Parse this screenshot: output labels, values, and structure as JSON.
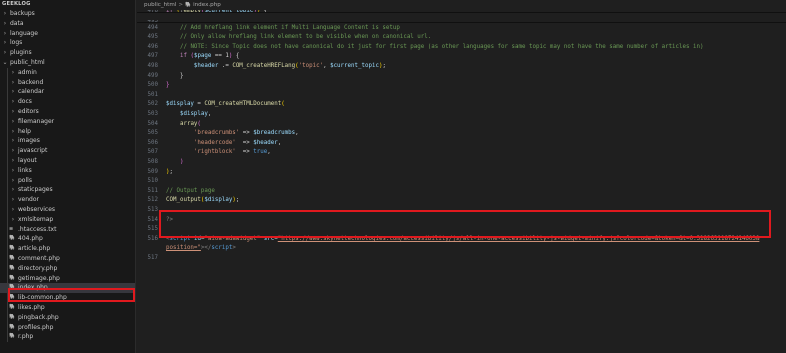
{
  "explorer": {
    "root_label": "GEEKLOG",
    "items": [
      {
        "label": "backups",
        "type": "folder",
        "depth": 0,
        "expanded": false
      },
      {
        "label": "data",
        "type": "folder",
        "depth": 0,
        "expanded": false
      },
      {
        "label": "language",
        "type": "folder",
        "depth": 0,
        "expanded": false
      },
      {
        "label": "logs",
        "type": "folder",
        "depth": 0,
        "expanded": false
      },
      {
        "label": "plugins",
        "type": "folder",
        "depth": 0,
        "expanded": false
      },
      {
        "label": "public_html",
        "type": "folder",
        "depth": 0,
        "expanded": true
      },
      {
        "label": "admin",
        "type": "folder",
        "depth": 1,
        "expanded": false
      },
      {
        "label": "backend",
        "type": "folder",
        "depth": 1,
        "expanded": false
      },
      {
        "label": "calendar",
        "type": "folder",
        "depth": 1,
        "expanded": false
      },
      {
        "label": "docs",
        "type": "folder",
        "depth": 1,
        "expanded": false
      },
      {
        "label": "editors",
        "type": "folder",
        "depth": 1,
        "expanded": false
      },
      {
        "label": "filemanager",
        "type": "folder",
        "depth": 1,
        "expanded": false
      },
      {
        "label": "help",
        "type": "folder",
        "depth": 1,
        "expanded": false
      },
      {
        "label": "images",
        "type": "folder",
        "depth": 1,
        "expanded": false
      },
      {
        "label": "javascript",
        "type": "folder",
        "depth": 1,
        "expanded": false
      },
      {
        "label": "layout",
        "type": "folder",
        "depth": 1,
        "expanded": false
      },
      {
        "label": "links",
        "type": "folder",
        "depth": 1,
        "expanded": false
      },
      {
        "label": "polls",
        "type": "folder",
        "depth": 1,
        "expanded": false
      },
      {
        "label": "staticpages",
        "type": "folder",
        "depth": 1,
        "expanded": false
      },
      {
        "label": "vendor",
        "type": "folder",
        "depth": 1,
        "expanded": false
      },
      {
        "label": "webservices",
        "type": "folder",
        "depth": 1,
        "expanded": false
      },
      {
        "label": "xmlsitemap",
        "type": "folder",
        "depth": 1,
        "expanded": false
      },
      {
        "label": ".htaccess.txt",
        "type": "file",
        "icon": "list-file-icon",
        "icon_glyph": "≡",
        "depth": 1
      },
      {
        "label": "404.php",
        "type": "file",
        "icon": "php-file-icon",
        "icon_glyph": "🐘",
        "depth": 1
      },
      {
        "label": "article.php",
        "type": "file",
        "icon": "php-file-icon",
        "icon_glyph": "🐘",
        "depth": 1
      },
      {
        "label": "comment.php",
        "type": "file",
        "icon": "php-file-icon",
        "icon_glyph": "🐘",
        "depth": 1
      },
      {
        "label": "directory.php",
        "type": "file",
        "icon": "php-file-icon",
        "icon_glyph": "🐘",
        "depth": 1
      },
      {
        "label": "getimage.php",
        "type": "file",
        "icon": "php-file-icon",
        "icon_glyph": "🐘",
        "depth": 1
      },
      {
        "label": "index.php",
        "type": "file",
        "icon": "php-file-icon",
        "icon_glyph": "🐘",
        "depth": 1,
        "selected": true,
        "highlighted": true
      },
      {
        "label": "lib-common.php",
        "type": "file",
        "icon": "php-file-icon",
        "icon_glyph": "🐘",
        "depth": 1
      },
      {
        "label": "likes.php",
        "type": "file",
        "icon": "php-file-icon",
        "icon_glyph": "🐘",
        "depth": 1
      },
      {
        "label": "pingback.php",
        "type": "file",
        "icon": "php-file-icon",
        "icon_glyph": "🐘",
        "depth": 1
      },
      {
        "label": "profiles.php",
        "type": "file",
        "icon": "php-file-icon",
        "icon_glyph": "🐘",
        "depth": 1
      },
      {
        "label": "r.php",
        "type": "file",
        "icon": "php-file-icon",
        "icon_glyph": "🐘",
        "depth": 1
      }
    ]
  },
  "breadcrumb": {
    "folder": "public_html",
    "separator": ">",
    "file_icon": "php-file-icon",
    "file_icon_glyph": "🐘",
    "file": "index.php"
  },
  "editor": {
    "lines": [
      {
        "n": "476",
        "shadowed": true,
        "tokens": [
          [
            "kw",
            "if "
          ],
          [
            "br",
            "("
          ],
          [
            "pl",
            "!"
          ],
          [
            "fn",
            "empty"
          ],
          [
            "br2",
            "("
          ],
          [
            "var",
            "$current_topic"
          ],
          [
            "br2",
            ")"
          ],
          [
            "br",
            ")"
          ],
          [
            "pl",
            " {"
          ]
        ]
      },
      {
        "n": "493",
        "shadowed": true,
        "tokens": [
          [
            "pl",
            " "
          ]
        ]
      },
      {
        "n": "494",
        "tokens": [
          [
            "pl",
            "    "
          ],
          [
            "cm",
            "// Add hreflang link element if Multi Language Content is setup"
          ]
        ]
      },
      {
        "n": "495",
        "tokens": [
          [
            "pl",
            "    "
          ],
          [
            "cm",
            "// Only allow hreflang link element to be visible when on canonical url."
          ]
        ]
      },
      {
        "n": "496",
        "tokens": [
          [
            "pl",
            "    "
          ],
          [
            "cm",
            "// NOTE: Since Topic does not have canonical do it just for first page (as other languages for same topic may not have the same number of articles in)"
          ]
        ]
      },
      {
        "n": "497",
        "tokens": [
          [
            "pl",
            "    "
          ],
          [
            "kw",
            "if "
          ],
          [
            "br2",
            "("
          ],
          [
            "var",
            "$page"
          ],
          [
            "pl",
            " == 1"
          ],
          [
            "br2",
            ")"
          ],
          [
            "pl",
            " {"
          ]
        ]
      },
      {
        "n": "498",
        "tokens": [
          [
            "pl",
            "        "
          ],
          [
            "var",
            "$header"
          ],
          [
            "pl",
            " .= "
          ],
          [
            "fn",
            "COM_createHREFLang"
          ],
          [
            "br",
            "("
          ],
          [
            "str",
            "'topic'"
          ],
          [
            "pl",
            ", "
          ],
          [
            "var",
            "$current_topic"
          ],
          [
            "br",
            ")"
          ],
          [
            "pl",
            ";"
          ]
        ]
      },
      {
        "n": "499",
        "tokens": [
          [
            "pl",
            "    }"
          ]
        ]
      },
      {
        "n": "500",
        "tokens": [
          [
            "br2",
            "}"
          ]
        ]
      },
      {
        "n": "501",
        "tokens": [
          [
            "pl",
            ""
          ]
        ]
      },
      {
        "n": "502",
        "tokens": [
          [
            "var",
            "$display"
          ],
          [
            "pl",
            " = "
          ],
          [
            "fn",
            "COM_createHTMLDocument"
          ],
          [
            "br",
            "("
          ]
        ]
      },
      {
        "n": "503",
        "tokens": [
          [
            "pl",
            "    "
          ],
          [
            "var",
            "$display"
          ],
          [
            "pl",
            ","
          ]
        ]
      },
      {
        "n": "504",
        "tokens": [
          [
            "pl",
            "    "
          ],
          [
            "fn",
            "array"
          ],
          [
            "br2",
            "("
          ]
        ]
      },
      {
        "n": "505",
        "tokens": [
          [
            "pl",
            "        "
          ],
          [
            "str",
            "'breadcrumbs'"
          ],
          [
            "pl",
            " => "
          ],
          [
            "var",
            "$breadcrumbs"
          ],
          [
            "pl",
            ","
          ]
        ]
      },
      {
        "n": "506",
        "tokens": [
          [
            "pl",
            "        "
          ],
          [
            "str",
            "'headercode'"
          ],
          [
            "pl",
            "  => "
          ],
          [
            "var",
            "$header"
          ],
          [
            "pl",
            ","
          ]
        ]
      },
      {
        "n": "507",
        "tokens": [
          [
            "pl",
            "        "
          ],
          [
            "str",
            "'rightblock'"
          ],
          [
            "pl",
            "  => "
          ],
          [
            "tn",
            "true"
          ],
          [
            "pl",
            ","
          ]
        ]
      },
      {
        "n": "508",
        "tokens": [
          [
            "pl",
            "    "
          ],
          [
            "br2",
            ")"
          ]
        ]
      },
      {
        "n": "509",
        "tokens": [
          [
            "br",
            ")"
          ],
          [
            "pl",
            ";"
          ]
        ]
      },
      {
        "n": "510",
        "tokens": [
          [
            "pl",
            ""
          ]
        ]
      },
      {
        "n": "511",
        "tokens": [
          [
            "cm",
            "// Output page"
          ]
        ]
      },
      {
        "n": "512",
        "tokens": [
          [
            "fn",
            "COM_output"
          ],
          [
            "br",
            "("
          ],
          [
            "var",
            "$display"
          ],
          [
            "br",
            ")"
          ],
          [
            "pl",
            ";"
          ]
        ]
      },
      {
        "n": "513",
        "tokens": [
          [
            "pl",
            ""
          ]
        ]
      },
      {
        "n": "514",
        "tokens": [
          [
            "tag",
            "?>"
          ]
        ]
      },
      {
        "n": "515",
        "tokens": [
          [
            "pl",
            ""
          ]
        ]
      },
      {
        "n": "516",
        "highlighted": true,
        "tokens": [
          [
            "tag",
            "<"
          ],
          [
            "tn",
            "script"
          ],
          [
            "pl",
            " "
          ],
          [
            "an",
            "id"
          ],
          [
            "pl",
            "="
          ],
          [
            "av2",
            "\"aioa-adawidget\""
          ],
          [
            "pl",
            " "
          ],
          [
            "an",
            "src"
          ],
          [
            "pl",
            "="
          ],
          [
            "av",
            "\"https://www.skynettechnologies.com/accessibility/js/all-in-one-accessibility-js-widget-minify.js?colorcode=&token=&t=0.31826311872414603&"
          ]
        ]
      },
      {
        "n": "",
        "tokens": [
          [
            "av",
            "position=\""
          ],
          [
            "tag",
            "></"
          ],
          [
            "tn",
            "script"
          ],
          [
            "tag",
            ">"
          ]
        ]
      },
      {
        "n": "517",
        "tokens": [
          [
            "pl",
            ""
          ]
        ]
      }
    ]
  },
  "colors": {
    "highlight_box": "#e0191e",
    "editor_bg": "#1f1f1f",
    "sidebar_bg": "#181818",
    "selected_bg": "#37373d"
  }
}
